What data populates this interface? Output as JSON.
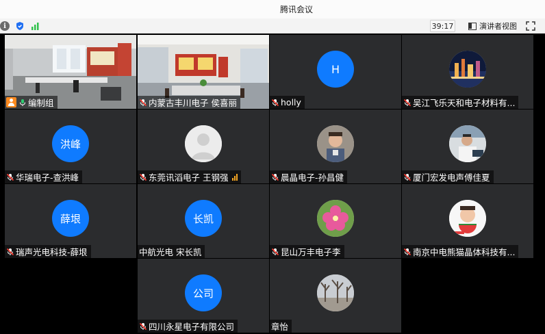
{
  "window": {
    "title": "腾讯会议"
  },
  "toolbar": {
    "timer": "39:17",
    "speaker_view_label": "演讲者视图",
    "colors": {
      "shield": "#1f6ff2",
      "signal": "#32c24d"
    }
  },
  "participants": [
    {
      "name": "编制组",
      "avatar_type": "video",
      "host": true
    },
    {
      "name": "内蒙古丰川电子 侯喜丽",
      "avatar_type": "video"
    },
    {
      "name": "holly",
      "avatar_type": "letter",
      "avatar_text": "H"
    },
    {
      "name": "吴江飞乐天和电子材料有...",
      "avatar_type": "photo",
      "icon": "city-night-icon"
    },
    {
      "name": "华瑞电子-查洪峰",
      "avatar_type": "text",
      "avatar_text": "洪峰"
    },
    {
      "name": "东莞讯滔电子 王钢强",
      "avatar_type": "photo",
      "icon": "default-person-icon",
      "signal_bars": true
    },
    {
      "name": "晨晶电子-孙昌健",
      "avatar_type": "photo",
      "icon": "child-photo-icon"
    },
    {
      "name": "厦门宏发电声傅佳夏",
      "avatar_type": "photo",
      "icon": "person-desk-icon"
    },
    {
      "name": "瑞声光电科技-薛垠",
      "avatar_type": "text",
      "avatar_text": "薛垠"
    },
    {
      "name": "中航光电 宋长凯",
      "avatar_type": "text",
      "avatar_text": "长凯",
      "no_mic": true
    },
    {
      "name": "昆山万丰电子李",
      "avatar_type": "photo",
      "icon": "pink-flower-icon"
    },
    {
      "name": "南京中电熊猫晶体科技有...",
      "avatar_type": "photo",
      "icon": "child-watermelon-icon"
    },
    {
      "name": "四川永星电子有限公司",
      "avatar_type": "text",
      "avatar_text": "公司"
    },
    {
      "name": "章怡",
      "avatar_type": "photo",
      "icon": "winter-trees-icon",
      "no_mic": true
    }
  ]
}
